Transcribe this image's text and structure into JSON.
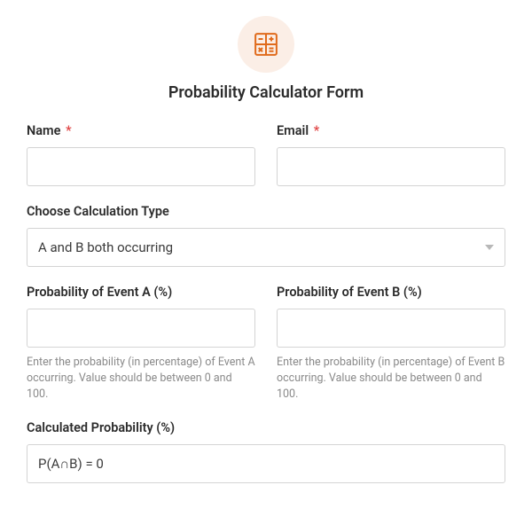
{
  "title": "Probability Calculator Form",
  "name": {
    "label": "Name",
    "required": "*"
  },
  "email": {
    "label": "Email",
    "required": "*"
  },
  "calcType": {
    "label": "Choose Calculation Type",
    "selected": "A and B both occurring"
  },
  "eventA": {
    "label": "Probability of Event A (%)",
    "hint": "Enter the probability (in percentage) of Event A occurring. Value should be between 0 and 100."
  },
  "eventB": {
    "label": "Probability of Event B (%)",
    "hint": "Enter the probability (in percentage) of Event B occurring. Value should be between 0 and 100."
  },
  "result": {
    "label": "Calculated Probability (%)",
    "value": "P(A∩B) = 0"
  }
}
